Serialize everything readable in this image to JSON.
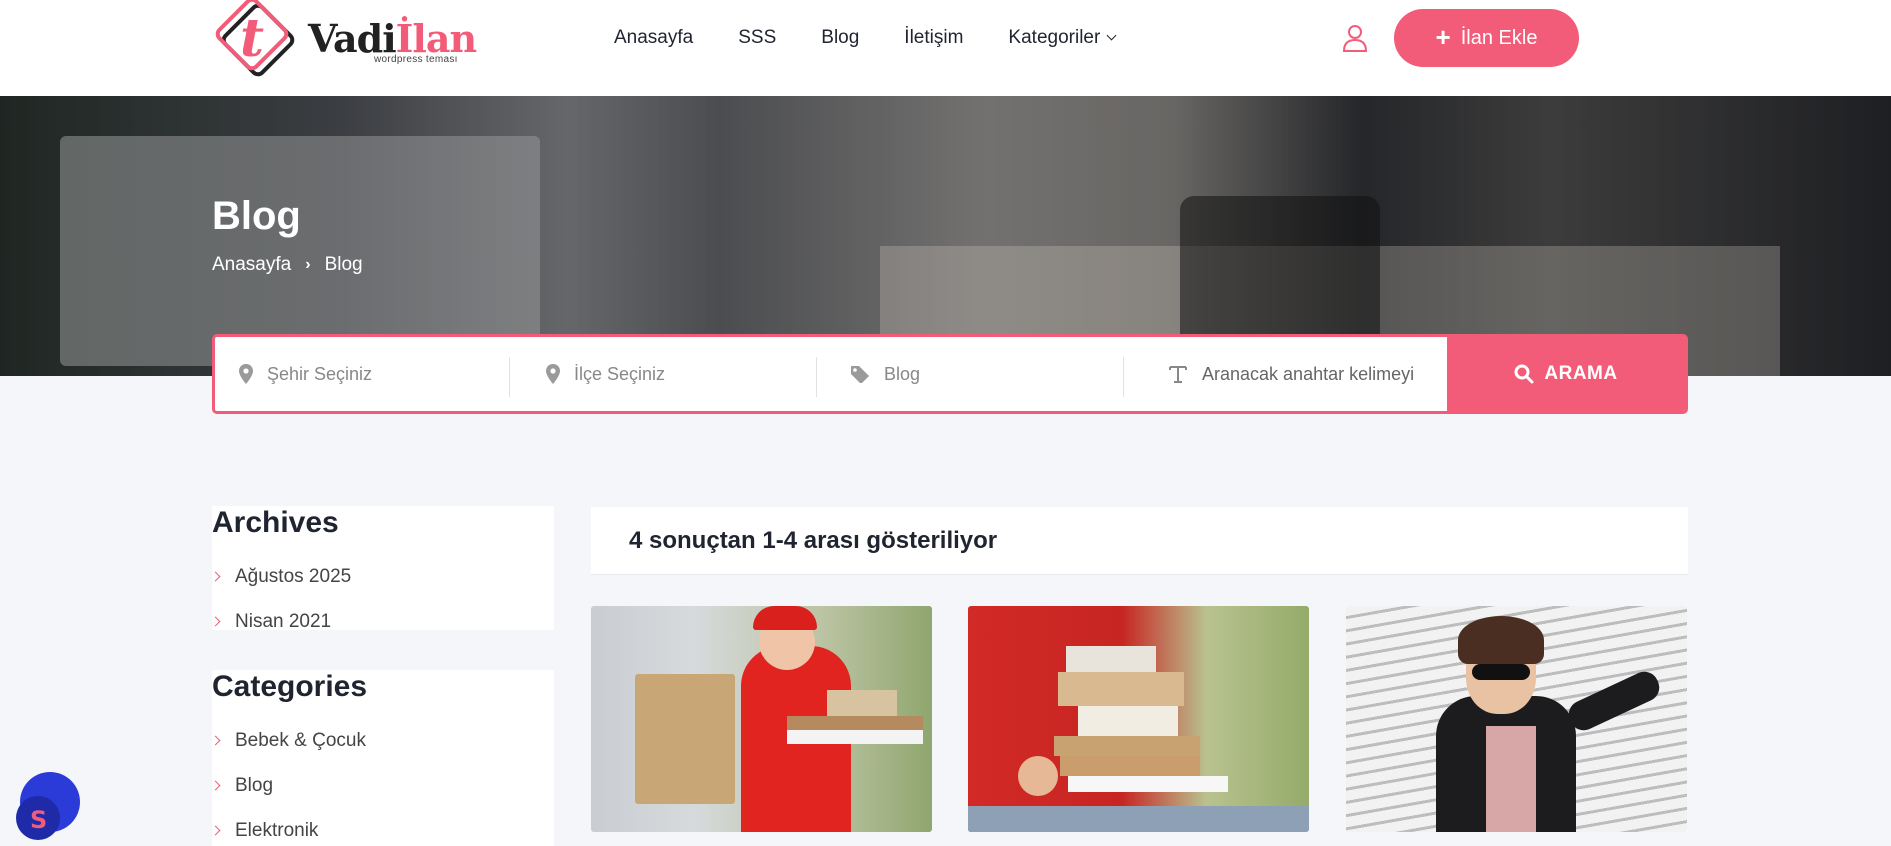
{
  "brand": {
    "name_part1": "Vadi",
    "name_part2": "İlan",
    "tagline": "wordpress teması"
  },
  "nav": {
    "items": [
      "Anasayfa",
      "SSS",
      "Blog",
      "İletişim"
    ],
    "dropdown_label": "Kategoriler"
  },
  "header": {
    "add_listing_label": "İlan Ekle"
  },
  "hero": {
    "title": "Blog",
    "breadcrumb": [
      "Anasayfa",
      "Blog"
    ]
  },
  "search": {
    "city_placeholder": "Şehir Seçiniz",
    "district_placeholder": "İlçe Seçiniz",
    "category_value": "Blog",
    "keyword_placeholder": "Aranacak anahtar kelimeyi",
    "button_label": "ARAMA"
  },
  "sidebar": {
    "archives_title": "Archives",
    "archives": [
      "Ağustos 2025",
      "Nisan 2021"
    ],
    "categories_title": "Categories",
    "categories": [
      "Bebek & Çocuk",
      "Blog",
      "Elektronik"
    ]
  },
  "results": {
    "summary": "4 sonuçtan 1-4 arası gösteriliyor"
  },
  "colors": {
    "accent": "#f25c78",
    "text": "#1f2430",
    "background": "#f5f6fa"
  }
}
